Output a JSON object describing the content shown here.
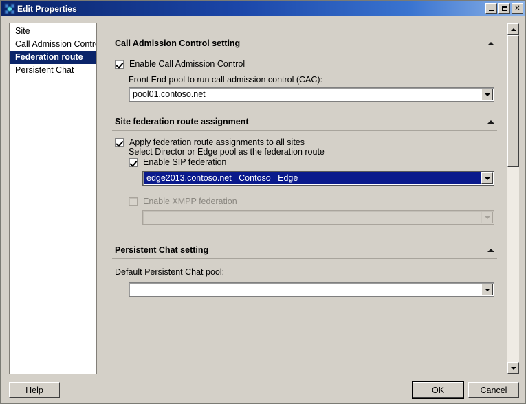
{
  "window": {
    "title": "Edit Properties",
    "icon": "topology-icon",
    "controls": {
      "minimize": "minimize-icon",
      "maximize": "maximize-icon",
      "close": "✕"
    }
  },
  "sidebar": {
    "items": [
      {
        "label": "Site",
        "selected": false
      },
      {
        "label": "Call Admission Control",
        "selected": false
      },
      {
        "label": "Federation route",
        "selected": true
      },
      {
        "label": "Persistent Chat",
        "selected": false
      }
    ]
  },
  "sections": {
    "cac": {
      "title": "Call Admission Control setting",
      "collapse_icon": "chevron-up-icon",
      "enable_checkbox": {
        "label": "Enable Call Admission Control",
        "checked": true
      },
      "pool_label": "Front End pool to run call admission control (CAC):",
      "pool_value": "pool01.contoso.net",
      "pool_dropdown_icon": "chevron-down-icon"
    },
    "federation": {
      "title": "Site federation route assignment",
      "collapse_icon": "chevron-up-icon",
      "apply_checkbox": {
        "label": "Apply federation route assignments to all sites",
        "checked": true
      },
      "hint": "Select Director or Edge pool as the federation route",
      "sip_checkbox": {
        "label": "Enable SIP federation",
        "checked": true
      },
      "sip_value": "edge2013.contoso.net   Contoso   Edge",
      "sip_dropdown_icon": "chevron-down-icon",
      "xmpp_checkbox": {
        "label": "Enable XMPP federation",
        "checked": false,
        "disabled": true
      },
      "xmpp_value": "",
      "xmpp_dropdown_icon": "chevron-down-icon"
    },
    "persistent_chat": {
      "title": "Persistent Chat setting",
      "collapse_icon": "chevron-up-icon",
      "pool_label": "Default Persistent Chat pool:",
      "pool_value": "",
      "pool_dropdown_icon": "chevron-down-icon"
    }
  },
  "scrollbar": {
    "up_icon": "triangle-up-icon",
    "down_icon": "triangle-down-icon"
  },
  "footer": {
    "help_label": "Help",
    "ok_label": "OK",
    "cancel_label": "Cancel"
  },
  "colors": {
    "dialog_face": "#d4d0c8",
    "title_blue": "#0a246a",
    "selection_blue": "#0a1a8c",
    "field_white": "#ffffff",
    "disabled_text": "#8a8780"
  }
}
